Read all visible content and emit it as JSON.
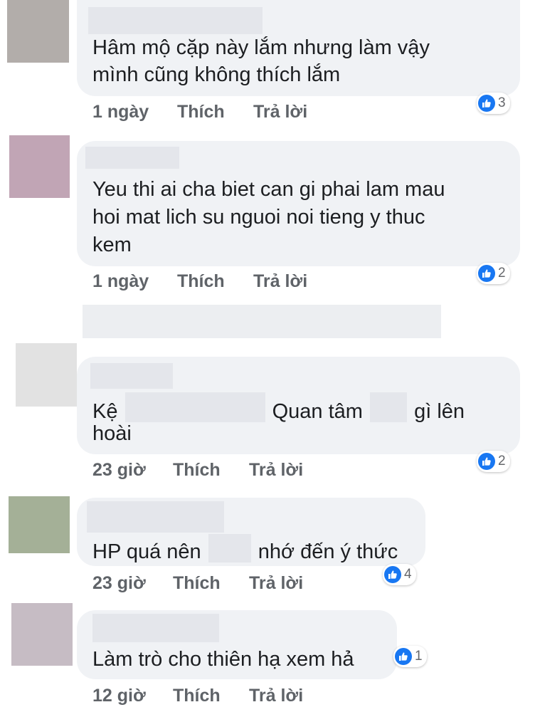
{
  "comments": [
    {
      "text": "Hâm mộ cặp này lắm nhưng làm vậy mình cũng không thích lắm",
      "line1": "Hâm mộ cặp này lắm nhưng làm vậy",
      "line2": "mình cũng không thích lắm",
      "time": "1 ngày",
      "like_label": "Thích",
      "reply_label": "Trả lời",
      "reactions": "3",
      "avatar_color": "#b2adaa"
    },
    {
      "line1": "Yeu thi ai cha biet can gi phai lam mau",
      "line2": "hoi mat lich su nguoi noi tieng y thuc",
      "line3": "kem",
      "time": "1 ngày",
      "like_label": "Thích",
      "reply_label": "Trả lời",
      "reactions": "2",
      "avatar_color": "#c1a5b5"
    },
    {
      "part1": "Kệ",
      "part2": "Quan tâm",
      "part3": "gì lên",
      "line2": "hoài",
      "time": "23 giờ",
      "like_label": "Thích",
      "reply_label": "Trả lời",
      "reactions": "2",
      "avatar_color": "#e2e2e2"
    },
    {
      "part1": "HP quá nên",
      "part2": "nhớ đến ý thức",
      "time": "23 giờ",
      "like_label": "Thích",
      "reply_label": "Trả lời",
      "reactions": "4",
      "avatar_color": "#a4b097"
    },
    {
      "line1": "Làm trò cho thiên hạ xem hả",
      "time": "12 giờ",
      "like_label": "Thích",
      "reply_label": "Trả lời",
      "reactions": "1",
      "avatar_color": "#c6bcc4"
    }
  ],
  "colors": {
    "bubble": "#f0f2f5",
    "meta_text": "#5f6368",
    "like_blue": "#1877f2",
    "redaction": "#e4e6eb"
  },
  "icons": [
    "like-icon"
  ]
}
